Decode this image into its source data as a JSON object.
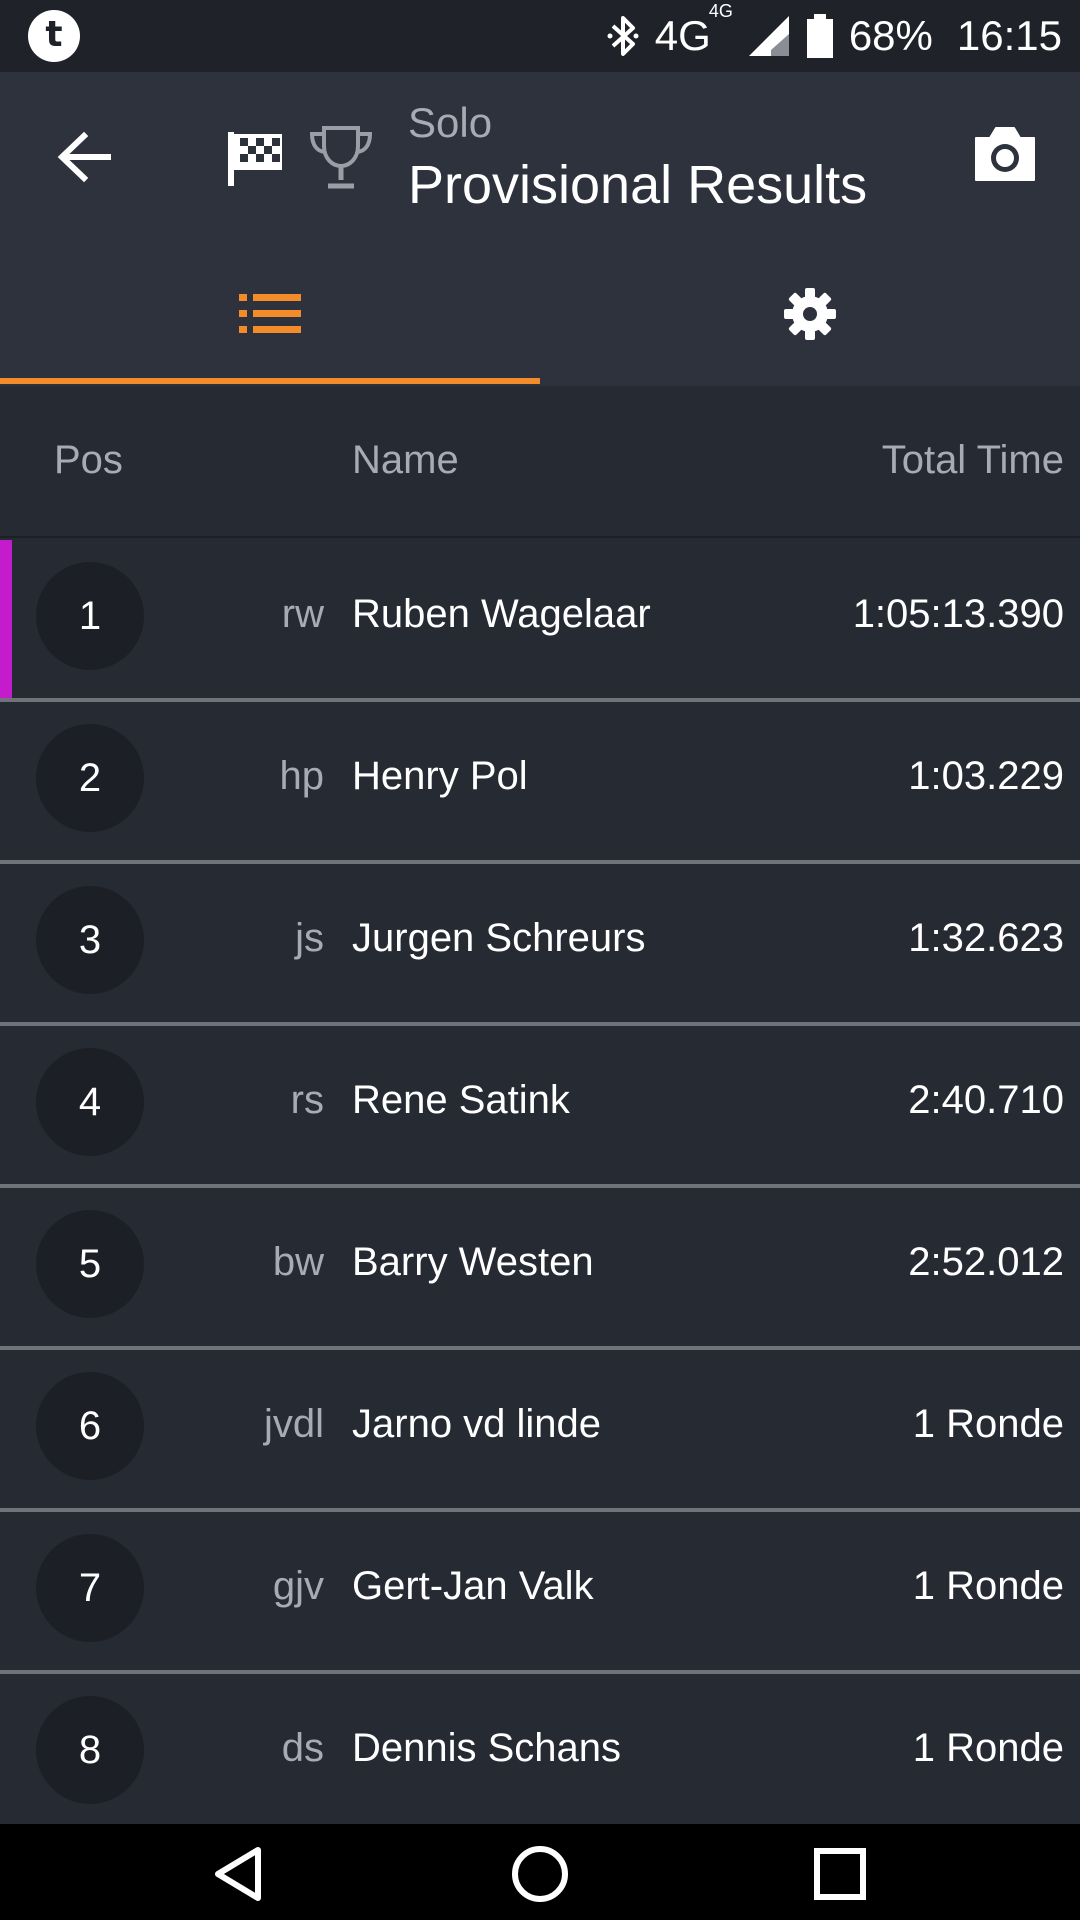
{
  "status_bar": {
    "app_badge": "t",
    "network": "4G",
    "network_sup": "4G",
    "battery": "68%",
    "time": "16:15"
  },
  "app_bar": {
    "subtitle": "Solo",
    "title": "Provisional Results"
  },
  "tabs": [
    {
      "name": "list",
      "icon": "list-icon",
      "selected": true
    },
    {
      "name": "settings",
      "icon": "gear-icon",
      "selected": false
    }
  ],
  "table": {
    "headers": {
      "pos": "Pos",
      "name": "Name",
      "time": "Total Time"
    },
    "rows": [
      {
        "pos": "1",
        "initials": "rw",
        "name": "Ruben Wagelaar",
        "time": "1:05:13.390",
        "accent": "#c41bcc"
      },
      {
        "pos": "2",
        "initials": "hp",
        "name": "Henry Pol",
        "time": "1:03.229"
      },
      {
        "pos": "3",
        "initials": "js",
        "name": "Jurgen Schreurs",
        "time": "1:32.623"
      },
      {
        "pos": "4",
        "initials": "rs",
        "name": "Rene Satink",
        "time": "2:40.710"
      },
      {
        "pos": "5",
        "initials": "bw",
        "name": "Barry Westen",
        "time": "2:52.012"
      },
      {
        "pos": "6",
        "initials": "jvdl",
        "name": "Jarno vd linde",
        "time": "1 Ronde"
      },
      {
        "pos": "7",
        "initials": "gjv",
        "name": "Gert-Jan Valk",
        "time": "1 Ronde"
      },
      {
        "pos": "8",
        "initials": "ds",
        "name": "Dennis Schans",
        "time": "1 Ronde"
      }
    ]
  },
  "colors": {
    "accent_orange": "#f28c2a",
    "leader_magenta": "#c41bcc",
    "background": "#262a33",
    "appbar": "#2d323c"
  }
}
